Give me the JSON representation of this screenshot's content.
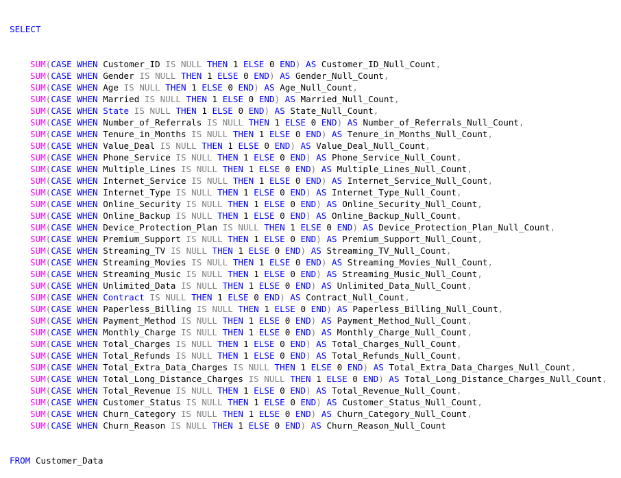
{
  "editor": {
    "header_keyword": "SELECT",
    "footer_keyword": "FROM",
    "table_name": "Customer_Data",
    "tokens": {
      "sum": "SUM",
      "open_paren": "(",
      "case": "CASE",
      "when": "WHEN",
      "is": "IS",
      "null": "NULL",
      "then": "THEN",
      "one": "1",
      "else": "ELSE",
      "zero": "0",
      "end": "END",
      "close_paren": ")",
      "as": "AS",
      "comma": ","
    },
    "colors": {
      "keyword": "#0000ff",
      "function": "#ff00ff",
      "operator": "#808080",
      "text": "#000000",
      "background": "#ffffff"
    },
    "columns": [
      {
        "name": "Customer_ID",
        "alias": "Customer_ID_Null_Count",
        "name_style": "plain"
      },
      {
        "name": "Gender",
        "alias": "Gender_Null_Count",
        "name_style": "plain"
      },
      {
        "name": "Age",
        "alias": "Age_Null_Count",
        "name_style": "plain"
      },
      {
        "name": "Married",
        "alias": "Married_Null_Count",
        "name_style": "plain"
      },
      {
        "name": "State",
        "alias": "State_Null_Count",
        "name_style": "keyword"
      },
      {
        "name": "Number_of_Referrals",
        "alias": "Number_of_Referrals_Null_Count",
        "name_style": "plain"
      },
      {
        "name": "Tenure_in_Months",
        "alias": "Tenure_in_Months_Null_Count",
        "name_style": "plain"
      },
      {
        "name": "Value_Deal",
        "alias": "Value_Deal_Null_Count",
        "name_style": "plain"
      },
      {
        "name": "Phone_Service",
        "alias": "Phone_Service_Null_Count",
        "name_style": "plain"
      },
      {
        "name": "Multiple_Lines",
        "alias": "Multiple_Lines_Null_Count",
        "name_style": "plain"
      },
      {
        "name": "Internet_Service",
        "alias": "Internet_Service_Null_Count",
        "name_style": "plain"
      },
      {
        "name": "Internet_Type",
        "alias": "Internet_Type_Null_Count",
        "name_style": "plain"
      },
      {
        "name": "Online_Security",
        "alias": "Online_Security_Null_Count",
        "name_style": "plain"
      },
      {
        "name": "Online_Backup",
        "alias": "Online_Backup_Null_Count",
        "name_style": "plain"
      },
      {
        "name": "Device_Protection_Plan",
        "alias": "Device_Protection_Plan_Null_Count",
        "name_style": "plain"
      },
      {
        "name": "Premium_Support",
        "alias": "Premium_Support_Null_Count",
        "name_style": "plain"
      },
      {
        "name": "Streaming_TV",
        "alias": "Streaming_TV_Null_Count",
        "name_style": "plain"
      },
      {
        "name": "Streaming_Movies",
        "alias": "Streaming_Movies_Null_Count",
        "name_style": "plain"
      },
      {
        "name": "Streaming_Music",
        "alias": "Streaming_Music_Null_Count",
        "name_style": "plain"
      },
      {
        "name": "Unlimited_Data",
        "alias": "Unlimited_Data_Null_Count",
        "name_style": "plain"
      },
      {
        "name": "Contract",
        "alias": "Contract_Null_Count",
        "name_style": "keyword"
      },
      {
        "name": "Paperless_Billing",
        "alias": "Paperless_Billing_Null_Count",
        "name_style": "plain"
      },
      {
        "name": "Payment_Method",
        "alias": "Payment_Method_Null_Count",
        "name_style": "plain"
      },
      {
        "name": "Monthly_Charge",
        "alias": "Monthly_Charge_Null_Count",
        "name_style": "plain"
      },
      {
        "name": "Total_Charges",
        "alias": "Total_Charges_Null_Count",
        "name_style": "plain"
      },
      {
        "name": "Total_Refunds",
        "alias": "Total_Refunds_Null_Count",
        "name_style": "plain"
      },
      {
        "name": "Total_Extra_Data_Charges",
        "alias": "Total_Extra_Data_Charges_Null_Count",
        "name_style": "plain"
      },
      {
        "name": "Total_Long_Distance_Charges",
        "alias": "Total_Long_Distance_Charges_Null_Count",
        "name_style": "plain"
      },
      {
        "name": "Total_Revenue",
        "alias": "Total_Revenue_Null_Count",
        "name_style": "plain"
      },
      {
        "name": "Customer_Status",
        "alias": "Customer_Status_Null_Count",
        "name_style": "plain"
      },
      {
        "name": "Churn_Category",
        "alias": "Churn_Category_Null_Count",
        "name_style": "plain"
      },
      {
        "name": "Churn_Reason",
        "alias": "Churn_Reason_Null_Count",
        "name_style": "plain"
      }
    ]
  }
}
